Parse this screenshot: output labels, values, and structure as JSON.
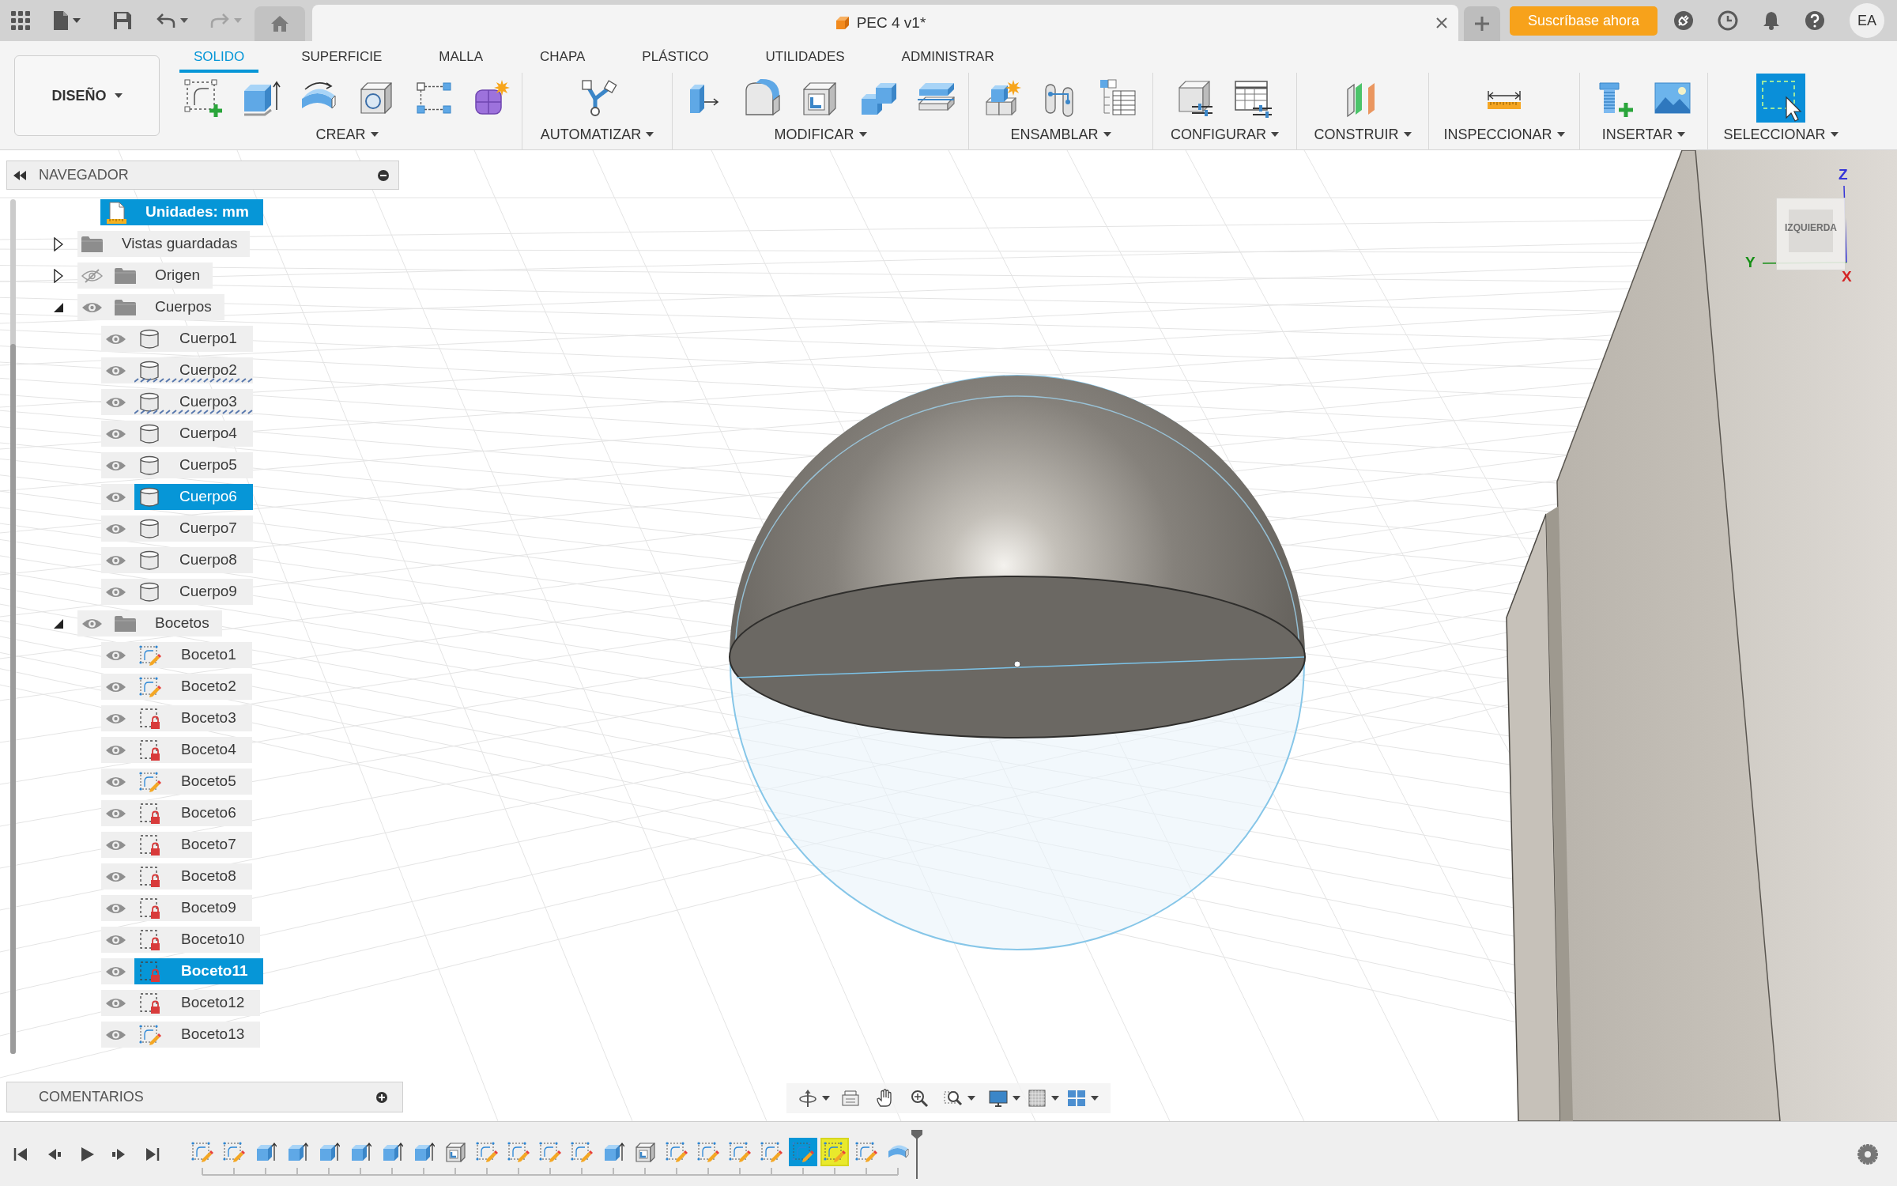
{
  "title_bar": {
    "undo": {
      "disabled": false
    },
    "redo": {
      "disabled": true
    },
    "document_tab": {
      "title": "PEC 4 v1*"
    },
    "subscribe_button": "Suscríbase ahora",
    "user_initials": "EA"
  },
  "toolbar": {
    "workspace": "DISEÑO",
    "tabs": [
      {
        "label": "SOLIDO",
        "selected": true
      },
      {
        "label": "SUPERFICIE",
        "selected": false
      },
      {
        "label": "MALLA",
        "selected": false
      },
      {
        "label": "CHAPA",
        "selected": false
      },
      {
        "label": "PLÁSTICO",
        "selected": false
      },
      {
        "label": "UTILIDADES",
        "selected": false
      },
      {
        "label": "ADMINISTRAR",
        "selected": false
      }
    ],
    "groups": [
      "CREAR",
      "AUTOMATIZAR",
      "MODIFICAR",
      "ENSAMBLAR",
      "CONFIGURAR",
      "CONSTRUIR",
      "INSPECCIONAR",
      "INSERTAR",
      "SELECCIONAR"
    ]
  },
  "browser": {
    "title": "NAVEGADOR",
    "items": [
      {
        "kind": "units",
        "label": "Unidades: mm",
        "selected": true
      },
      {
        "kind": "folder",
        "label": "Vistas guardadas",
        "expanded": false,
        "selected": false
      },
      {
        "kind": "folder",
        "label": "Origen",
        "expanded": false,
        "visible": false,
        "selected": false
      },
      {
        "kind": "folder",
        "label": "Cuerpos",
        "expanded": true,
        "visible": true,
        "selected": false,
        "children": [
          {
            "kind": "body",
            "label": "Cuerpo1",
            "visible": true,
            "selected": false,
            "flagged": false
          },
          {
            "kind": "body",
            "label": "Cuerpo2",
            "visible": true,
            "selected": false,
            "flagged": true
          },
          {
            "kind": "body",
            "label": "Cuerpo3",
            "visible": true,
            "selected": false,
            "flagged": true
          },
          {
            "kind": "body",
            "label": "Cuerpo4",
            "visible": true,
            "selected": false,
            "flagged": false
          },
          {
            "kind": "body",
            "label": "Cuerpo5",
            "visible": true,
            "selected": false,
            "flagged": false
          },
          {
            "kind": "body",
            "label": "Cuerpo6",
            "visible": true,
            "selected": true,
            "flagged": false
          },
          {
            "kind": "body",
            "label": "Cuerpo7",
            "visible": true,
            "selected": false,
            "flagged": false
          },
          {
            "kind": "body",
            "label": "Cuerpo8",
            "visible": true,
            "selected": false,
            "flagged": false
          },
          {
            "kind": "body",
            "label": "Cuerpo9",
            "visible": true,
            "selected": false,
            "flagged": false
          }
        ]
      },
      {
        "kind": "folder",
        "label": "Bocetos",
        "expanded": true,
        "visible": true,
        "selected": false,
        "children": [
          {
            "kind": "sketch",
            "label": "Boceto1",
            "visible": true,
            "selected": false,
            "active": false
          },
          {
            "kind": "sketch",
            "label": "Boceto2",
            "visible": true,
            "selected": false,
            "active": false
          },
          {
            "kind": "locked_sketch",
            "label": "Boceto3",
            "visible": true,
            "selected": false,
            "active": false
          },
          {
            "kind": "locked_sketch",
            "label": "Boceto4",
            "visible": true,
            "selected": false,
            "active": false
          },
          {
            "kind": "sketch",
            "label": "Boceto5",
            "visible": true,
            "selected": false,
            "active": false
          },
          {
            "kind": "locked_sketch",
            "label": "Boceto6",
            "visible": true,
            "selected": false,
            "active": false
          },
          {
            "kind": "locked_sketch",
            "label": "Boceto7",
            "visible": true,
            "selected": false,
            "active": false
          },
          {
            "kind": "locked_sketch",
            "label": "Boceto8",
            "visible": true,
            "selected": false,
            "active": false
          },
          {
            "kind": "locked_sketch",
            "label": "Boceto9",
            "visible": true,
            "selected": false,
            "active": false
          },
          {
            "kind": "locked_sketch",
            "label": "Boceto10",
            "visible": true,
            "selected": false,
            "active": false
          },
          {
            "kind": "locked_sketch",
            "label": "Boceto11",
            "visible": true,
            "selected": true,
            "active": true
          },
          {
            "kind": "locked_sketch",
            "label": "Boceto12",
            "visible": true,
            "selected": false,
            "active": false
          },
          {
            "kind": "sketch",
            "label": "Boceto13",
            "visible": true,
            "selected": false,
            "active": false
          }
        ]
      }
    ]
  },
  "viewcube": {
    "face": "IZQUIERDA",
    "axes": [
      {
        "label": "Z",
        "color": "#3434d8"
      },
      {
        "label": "Y",
        "color": "#168f16"
      },
      {
        "label": "X",
        "color": "#d42424"
      }
    ]
  },
  "comments": {
    "title": "COMENTARIOS"
  },
  "timeline": {
    "items": [
      {
        "kind": "sketch",
        "selected": false,
        "highlighted": false
      },
      {
        "kind": "sketch",
        "selected": false,
        "highlighted": false
      },
      {
        "kind": "extrude",
        "selected": false,
        "highlighted": false
      },
      {
        "kind": "extrude",
        "selected": false,
        "highlighted": false
      },
      {
        "kind": "extrude",
        "selected": false,
        "highlighted": false
      },
      {
        "kind": "extrude",
        "selected": false,
        "highlighted": false
      },
      {
        "kind": "extrude",
        "selected": false,
        "highlighted": false
      },
      {
        "kind": "extrude",
        "selected": false,
        "highlighted": false
      },
      {
        "kind": "shell",
        "selected": false,
        "highlighted": false
      },
      {
        "kind": "sketch",
        "selected": false,
        "highlighted": false
      },
      {
        "kind": "sketch",
        "selected": false,
        "highlighted": false
      },
      {
        "kind": "sketch",
        "selected": false,
        "highlighted": false
      },
      {
        "kind": "sketch",
        "selected": false,
        "highlighted": false
      },
      {
        "kind": "extrude",
        "selected": false,
        "highlighted": false
      },
      {
        "kind": "shell",
        "selected": false,
        "highlighted": false
      },
      {
        "kind": "sketch",
        "selected": false,
        "highlighted": false
      },
      {
        "kind": "sketch",
        "selected": false,
        "highlighted": false
      },
      {
        "kind": "sketch",
        "selected": false,
        "highlighted": false
      },
      {
        "kind": "sketch",
        "selected": false,
        "highlighted": false
      },
      {
        "kind": "sketch",
        "selected": true,
        "highlighted": false
      },
      {
        "kind": "sketch",
        "selected": false,
        "highlighted": true
      },
      {
        "kind": "sketch",
        "selected": false,
        "highlighted": false
      },
      {
        "kind": "revolve",
        "selected": false,
        "highlighted": false
      }
    ]
  }
}
